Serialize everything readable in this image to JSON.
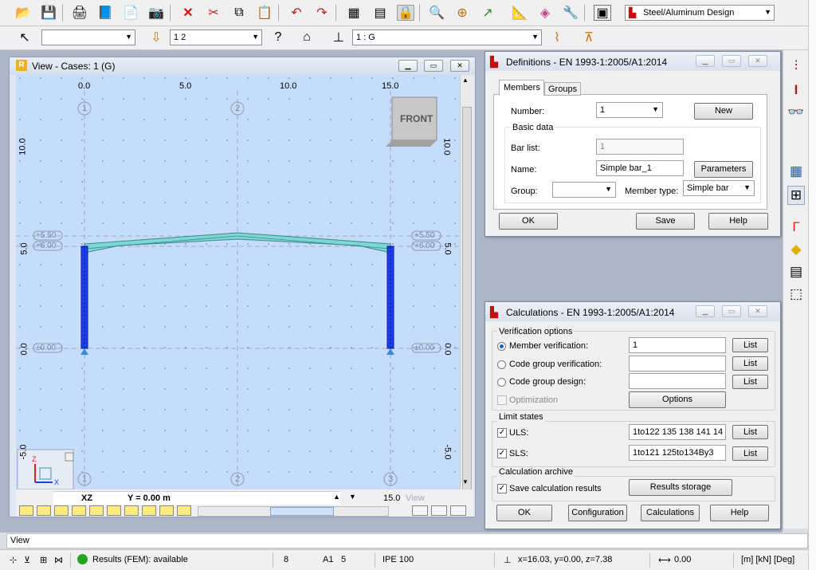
{
  "toolbar1": {
    "design_combo": "Steel/Aluminum Design"
  },
  "toolbar2": {
    "combo_empty": "",
    "combo_load": "1 2",
    "combo_result": "1 : G"
  },
  "view": {
    "title": "View - Cases: 1 (G)",
    "top_ticks": [
      "0.0",
      "5.0",
      "10.0",
      "15.0"
    ],
    "left_ticks": [
      "10.0",
      "5.0",
      "0.0",
      "-5.0"
    ],
    "right_ticks": [
      "10.0",
      "5.0",
      "0.0",
      "-5.0"
    ],
    "node_numbers": [
      "1",
      "2",
      "3"
    ],
    "elev_tags": [
      "+5.50",
      "+6.00",
      "±0.00"
    ],
    "front_label": "FRONT",
    "axis_x": "X",
    "axis_z": "Z",
    "plane_label": "XZ",
    "y_label": "Y = 0.00 m",
    "bottom_tick": "15.0",
    "bottom_watermark": "View",
    "colors": {
      "canvas": "#c5dcfa",
      "column": "#1e3cf0",
      "rafter": "#7fd6d6"
    }
  },
  "definitions": {
    "title": "Definitions - EN 1993-1:2005/A1:2014",
    "tabs": [
      "Members",
      "Groups"
    ],
    "number_label": "Number:",
    "number_value": "1",
    "new_button": "New",
    "basic_data": "Basic data",
    "bar_list_label": "Bar list:",
    "bar_list_value": "1",
    "name_label": "Name:",
    "name_value": "Simple bar_1",
    "parameters_button": "Parameters",
    "group_label": "Group:",
    "group_value": "",
    "member_type_label": "Member type:",
    "member_type_value": "Simple bar",
    "ok": "OK",
    "save": "Save",
    "help": "Help"
  },
  "calculations": {
    "title": "Calculations - EN 1993-1:2005/A1:2014",
    "verification_options": "Verification options",
    "member_verification": "Member verification:",
    "member_verification_value": "1",
    "code_group_verification": "Code group verification:",
    "code_group_design": "Code group design:",
    "optimization": "Optimization",
    "options_button": "Options",
    "list_button": "List",
    "limit_states": "Limit states",
    "uls": "ULS:",
    "uls_value": "1to122 135 138 141 14",
    "sls": "SLS:",
    "sls_value": "1to121 125to134By3",
    "archive": "Calculation archive",
    "save_results": "Save calculation results",
    "results_storage": "Results storage",
    "ok": "OK",
    "configuration": "Configuration",
    "calculations_button": "Calculations",
    "help": "Help"
  },
  "viewtab": "View",
  "status": {
    "results": "Results (FEM): available",
    "value1": "8",
    "value2": "5",
    "section": "IPE 100",
    "coords": "x=16.03, y=0.00, z=7.38",
    "length": "0.00",
    "units": "[m] [kN] [Deg]"
  }
}
